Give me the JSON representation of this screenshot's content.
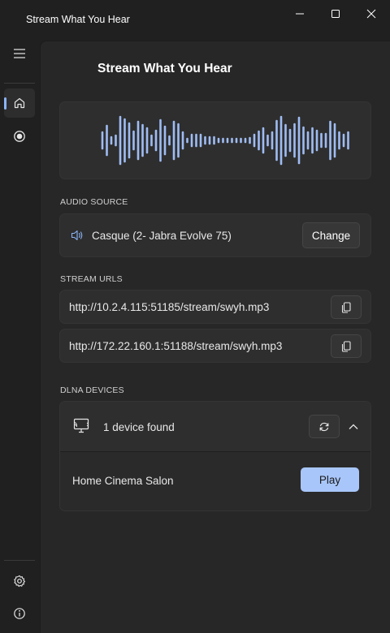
{
  "window": {
    "title": "Stream What You Hear",
    "controls": [
      "minimize-icon",
      "maximize-icon",
      "close-icon"
    ]
  },
  "sidebar": {
    "top_icon": "hamburger-menu-icon",
    "items": [
      {
        "icon": "home-icon",
        "active": true
      },
      {
        "icon": "record-icon",
        "active": false
      }
    ],
    "bottom_items": [
      {
        "icon": "gear-icon"
      },
      {
        "icon": "info-icon"
      }
    ]
  },
  "header": {
    "title": "Stream What You Hear",
    "logo_icon": "soundwave-logo-icon"
  },
  "audio_source": {
    "label": "AUDIO SOURCE",
    "device": "Casque (2- Jabra Evolve 75)",
    "change_label": "Change",
    "icon": "speaker-icon"
  },
  "stream_urls": {
    "label": "STREAM URLS",
    "urls": [
      "http://10.2.4.115:51185/stream/swyh.mp3",
      "http://172.22.160.1:51188/stream/swyh.mp3"
    ],
    "copy_icon": "copy-icon"
  },
  "dlna": {
    "label": "DLNA DEVICES",
    "status": "1 device found",
    "monitor_icon": "cast-monitor-icon",
    "refresh_icon": "refresh-icon",
    "collapse_icon": "chevron-up-icon",
    "devices": [
      {
        "name": "Home Cinema Salon",
        "action": "Play"
      }
    ]
  },
  "colors": {
    "accent": "#8bb4f8",
    "play_button": "#a8c6fa",
    "wave": "#9fbcf3",
    "background": "#202020",
    "panel": "#272727",
    "card": "#2e2e2e"
  }
}
